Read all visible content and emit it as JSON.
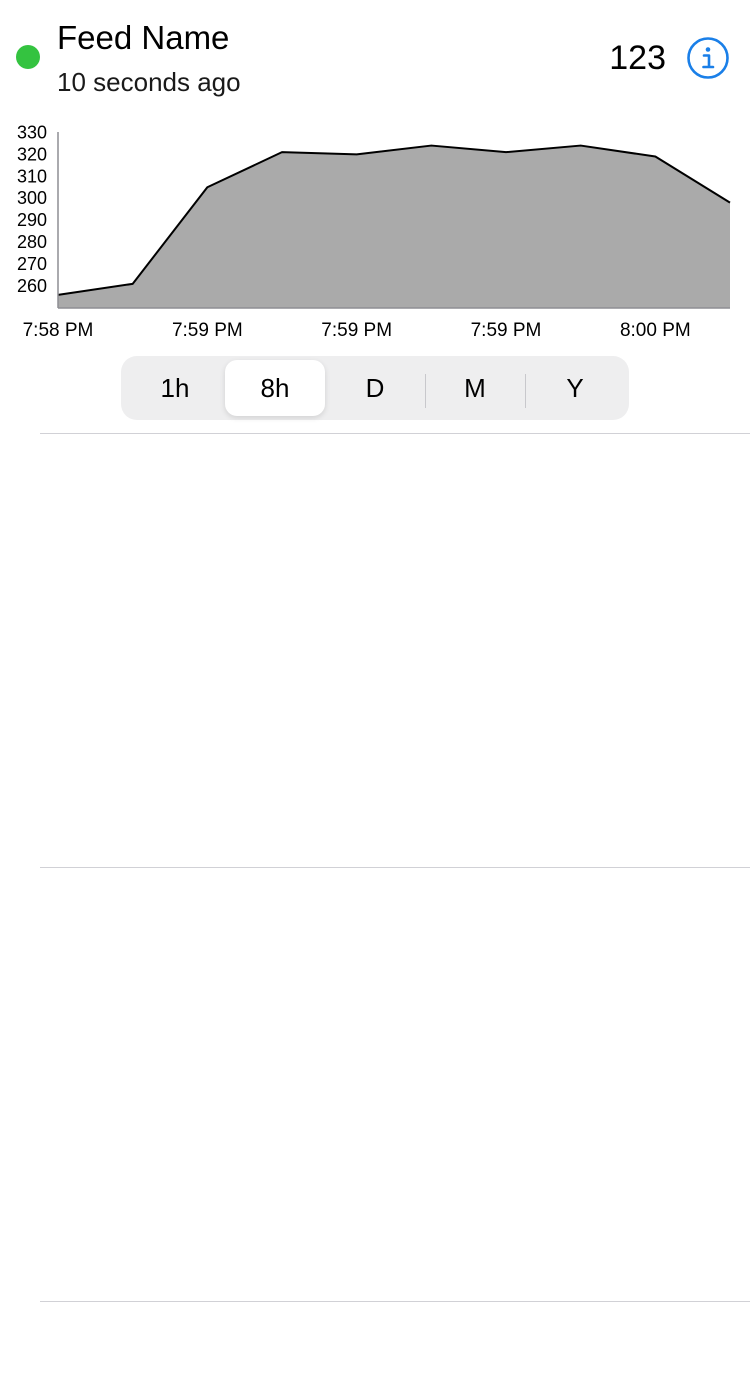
{
  "feed": {
    "name": "Feed Name",
    "updated": "10 seconds ago",
    "value": "123",
    "status_color": "#34c340"
  },
  "info_icon": "info-circle-icon",
  "accent_color": "#1a7fe8",
  "chart_data": {
    "type": "area",
    "x": [
      "7:58 PM",
      "",
      "7:59 PM",
      "",
      "7:59 PM",
      "",
      "7:59 PM",
      "",
      "8:00 PM",
      ""
    ],
    "x_tick_labels": [
      "7:58 PM",
      "7:59 PM",
      "7:59 PM",
      "7:59 PM",
      "8:00 PM"
    ],
    "values": [
      256,
      261,
      305,
      321,
      320,
      324,
      321,
      324,
      319,
      298
    ],
    "y_ticks": [
      260,
      270,
      280,
      290,
      300,
      310,
      320,
      330
    ],
    "ylim": [
      250,
      332
    ],
    "fill_color": "#aaaaaa",
    "line_color": "#000000",
    "grid": false
  },
  "range_selector": {
    "options": [
      "1h",
      "8h",
      "D",
      "M",
      "Y"
    ],
    "selected": "8h"
  }
}
